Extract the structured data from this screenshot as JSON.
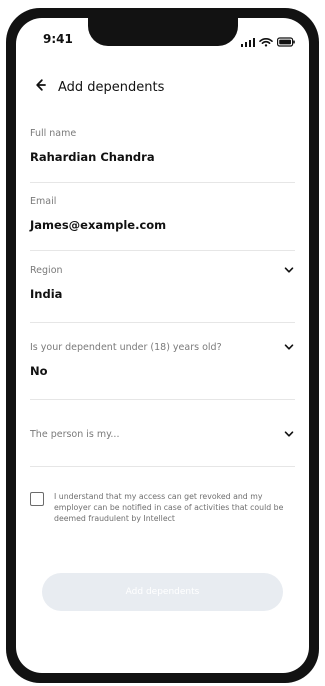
{
  "status_bar": {
    "time": "9:41",
    "icons": [
      "signal-icon",
      "wifi-icon",
      "battery-icon"
    ]
  },
  "header": {
    "title": "Add dependents",
    "back_icon": "arrow-left-icon"
  },
  "form": {
    "full_name": {
      "label": "Full name",
      "value": "Rahardian Chandra"
    },
    "email": {
      "label": "Email",
      "value": "James@example.com"
    },
    "region": {
      "label": "Region",
      "value": "India",
      "chevron_icon": "chevron-down-icon"
    },
    "under_18": {
      "label": "Is your dependent under (18) years old?",
      "value": "No",
      "chevron_icon": "chevron-down-icon"
    },
    "relationship": {
      "label": "The person is my...",
      "value": "",
      "chevron_icon": "chevron-down-icon"
    }
  },
  "consent": {
    "checked": false,
    "text": "I understand that my access can get revoked and my employer can be notified in case of activities that could be deemed fraudulent by Intellect"
  },
  "actions": {
    "submit_label": "Add dependents"
  },
  "colors": {
    "frame": "#121212",
    "divider": "#e6e6e6",
    "label": "#7a7a7a",
    "button_disabled_bg": "#e8ecf1"
  }
}
